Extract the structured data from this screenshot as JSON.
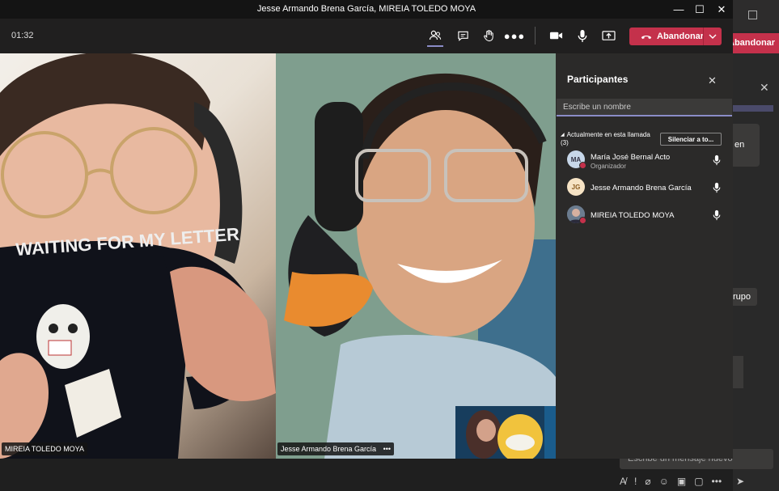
{
  "window": {
    "title": "Jesse Armando Brena García, MIREIA TOLEDO MOYA"
  },
  "toolbar": {
    "timer": "01:32",
    "leave_label": "Abandonar"
  },
  "videos": {
    "left_name": "MIREIA TOLEDO MOYA",
    "right_name": "Jesse Armando Brena García",
    "more": "•••"
  },
  "participants": {
    "title": "Participantes",
    "search_placeholder": "Escribe un nombre",
    "section_line1": "Actualmente en esta llamada",
    "section_line2": "(3)",
    "mute_all_label": "Silenciar a to...",
    "people": [
      {
        "initials": "MA",
        "name": "María José Bernal Acto",
        "role": "Organizador",
        "avatar_color": "#c7d7e9"
      },
      {
        "initials": "JG",
        "name": "Jesse Armando Brena García",
        "role": "",
        "avatar_color": "#f6e3c4"
      },
      {
        "initials": "",
        "name": "MIREIA TOLEDO MOYA",
        "role": "",
        "avatar_color": "#6b7c8f"
      }
    ]
  },
  "background_app": {
    "button_label": "Abandonar",
    "card1_text": "en",
    "card2_text": "rupo",
    "compose_placeholder": "Escribe un mensaje nuevo"
  },
  "colors": {
    "accent": "#c4314b",
    "focus": "#8b8cc7"
  }
}
